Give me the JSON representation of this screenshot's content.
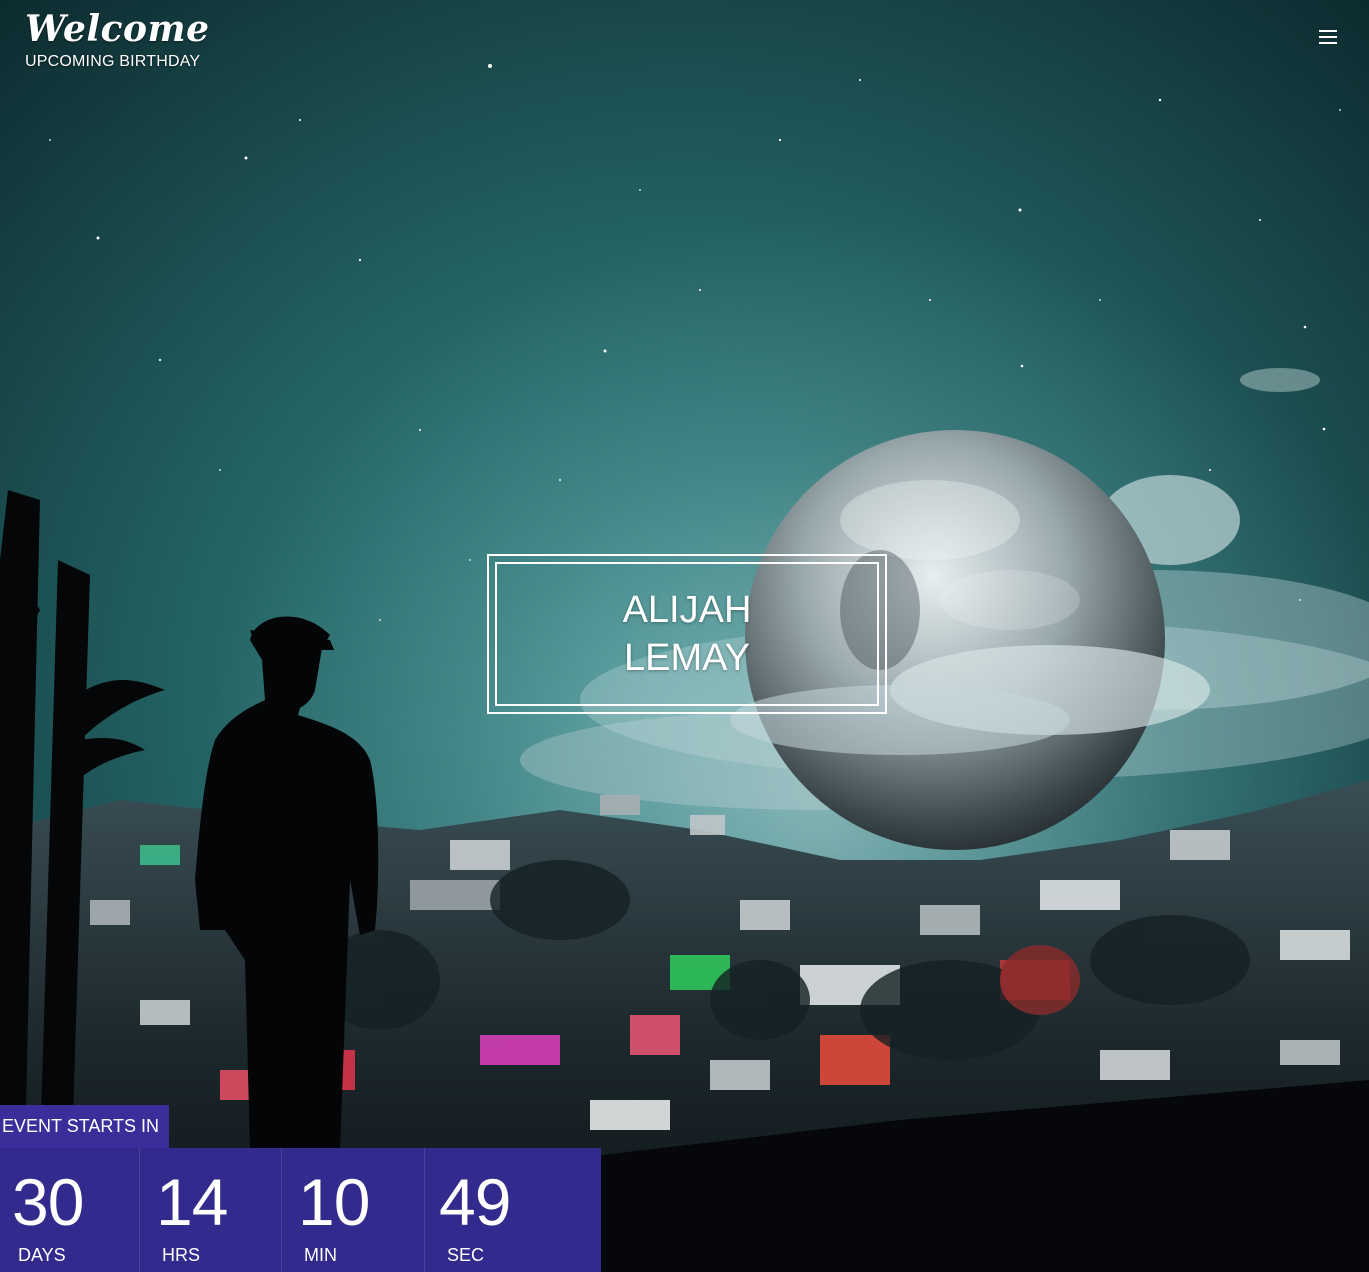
{
  "header": {
    "title": "Welcome",
    "subtitle": "UPCOMING BIRTHDAY",
    "menu_icon": "hamburger-menu-icon"
  },
  "hero": {
    "name_line1": "ALIJAH",
    "name_line2": "LEMAY"
  },
  "countdown": {
    "label": "EVENT STARTS IN",
    "days": "30",
    "days_label": "DAYS",
    "hours": "14",
    "hours_label": "HRS",
    "minutes": "10",
    "minutes_label": "MIN",
    "seconds": "49",
    "seconds_label": "SEC"
  },
  "colors": {
    "countdown_bg": "#322a8c",
    "label_bg": "#3b2e9a",
    "sky_top": "#0f3336",
    "sky_mid": "#2b7475"
  }
}
